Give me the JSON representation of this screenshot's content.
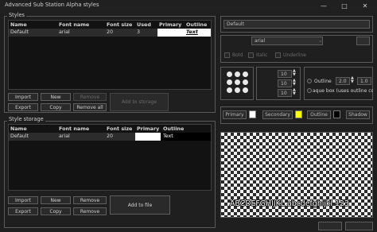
{
  "window": {
    "title": "Advanced Sub Station Alpha styles"
  },
  "styles": {
    "label": "Styles",
    "columns": [
      "Name",
      "Font name",
      "Font size",
      "Used",
      "Primary",
      "Outline"
    ],
    "rows": [
      {
        "name": "Default",
        "font": "arial",
        "size": "20",
        "used": "3",
        "primary": "",
        "outline": "Text"
      }
    ],
    "buttons": {
      "import": "Import",
      "new": "New",
      "remove": "Remove",
      "export": "Export",
      "copy": "Copy",
      "remove_all": "Remove all",
      "add_to_storage": "Add to storage"
    }
  },
  "storage": {
    "label": "Style storage",
    "columns": [
      "Name",
      "Font name",
      "Font size",
      "Primary",
      "Outline"
    ],
    "rows": [
      {
        "name": "Default",
        "font": "arial",
        "size": "20",
        "primary": "",
        "outline": "Text"
      }
    ],
    "buttons": {
      "import": "Import",
      "new": "New",
      "remove": "Remove",
      "export": "Export",
      "copy": "Copy",
      "remove2": "Remove",
      "add_to_file": "Add to file"
    }
  },
  "editor": {
    "name_value": "Default",
    "font_value": "arial",
    "bold": "Bold",
    "italic": "Italic",
    "underline": "Underline",
    "margin_v1": "10",
    "margin_v2": "10",
    "margin_v3": "10",
    "outline_label": "Outline",
    "outline_value": "2.0",
    "shadow_value": "1.0",
    "opaque_box": "aque box (uses outline co",
    "primary": "Primary",
    "secondary": "Secondary",
    "outline": "Outline",
    "shadow": "Shadow",
    "preview_text": "ABCDEFGHIJKL abcdefghijkl 123",
    "primary_color": "#ffffff",
    "secondary_color": "#ffff00",
    "outline_color": "#000000",
    "shadow_color": "#000000"
  }
}
